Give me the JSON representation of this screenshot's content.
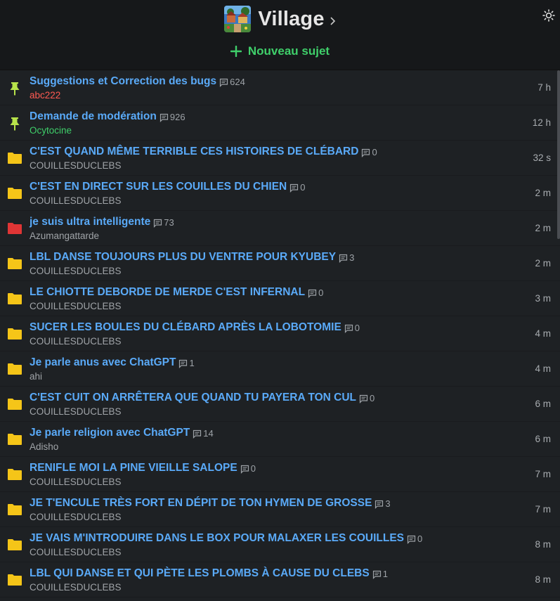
{
  "forum": {
    "title": "Village",
    "new_topic_label": "Nouveau sujet"
  },
  "colors": {
    "accent_green": "#3fcf6a",
    "link_blue": "#5aaaf8",
    "author_admin": "#ff5a52",
    "author_mod": "#3fcf6a",
    "folder_yellow": "#f5c518",
    "folder_red": "#e03535",
    "pin_green": "#b7e34a"
  },
  "topics": [
    {
      "title": "Suggestions et Correction des bugs",
      "replies": "624",
      "author": "abc222",
      "time": "7 h",
      "icon": "pin-icon",
      "author_role": "admin"
    },
    {
      "title": "Demande de modération",
      "replies": "926",
      "author": "Ocytocine",
      "time": "12 h",
      "icon": "pin-icon",
      "author_role": "mod"
    },
    {
      "title": "C'EST QUAND MÊME TERRIBLE CES HISTOIRES DE CLÉBARD",
      "replies": "0",
      "author": "COUILLESDUCLEBS",
      "time": "32 s",
      "icon": "folder-icon"
    },
    {
      "title": "C'EST EN DIRECT SUR LES COUILLES DU CHIEN",
      "replies": "0",
      "author": "COUILLESDUCLEBS",
      "time": "2 m",
      "icon": "folder-icon"
    },
    {
      "title": "je suis ultra intelligente",
      "replies": "73",
      "author": "Azumangattarde",
      "time": "2 m",
      "icon": "folder-hot-icon"
    },
    {
      "title": "LBL DANSE TOUJOURS PLUS DU VENTRE POUR KYUBEY",
      "replies": "3",
      "author": "COUILLESDUCLEBS",
      "time": "2 m",
      "icon": "folder-icon"
    },
    {
      "title": "LE CHIOTTE DEBORDE DE MERDE C'EST INFERNAL",
      "replies": "0",
      "author": "COUILLESDUCLEBS",
      "time": "3 m",
      "icon": "folder-icon"
    },
    {
      "title": "SUCER LES BOULES DU CLÉBARD APRÈS LA LOBOTOMIE",
      "replies": "0",
      "author": "COUILLESDUCLEBS",
      "time": "4 m",
      "icon": "folder-icon"
    },
    {
      "title": "Je parle anus avec ChatGPT",
      "replies": "1",
      "author": "ahi",
      "time": "4 m",
      "icon": "folder-icon"
    },
    {
      "title": "C'EST CUIT ON ARRÊTERA QUE QUAND TU PAYERA TON CUL",
      "replies": "0",
      "author": "COUILLESDUCLEBS",
      "time": "6 m",
      "icon": "folder-icon"
    },
    {
      "title": "Je parle religion avec ChatGPT",
      "replies": "14",
      "author": "Adisho",
      "time": "6 m",
      "icon": "folder-icon"
    },
    {
      "title": "RENIFLE MOI LA PINE VIEILLE SALOPE",
      "replies": "0",
      "author": "COUILLESDUCLEBS",
      "time": "7 m",
      "icon": "folder-icon"
    },
    {
      "title": "JE T'ENCULE TRÈS FORT EN DÉPIT DE TON HYMEN DE GROSSE",
      "replies": "3",
      "author": "COUILLESDUCLEBS",
      "time": "7 m",
      "icon": "folder-icon"
    },
    {
      "title": "JE VAIS M'INTRODUIRE DANS LE BOX POUR MALAXER LES COUILLES",
      "replies": "0",
      "author": "COUILLESDUCLEBS",
      "time": "8 m",
      "icon": "folder-icon"
    },
    {
      "title": "LBL QUI DANSE ET QUI PÈTE LES PLOMBS À CAUSE DU CLEBS",
      "replies": "1",
      "author": "COUILLESDUCLEBS",
      "time": "8 m",
      "icon": "folder-icon"
    }
  ]
}
